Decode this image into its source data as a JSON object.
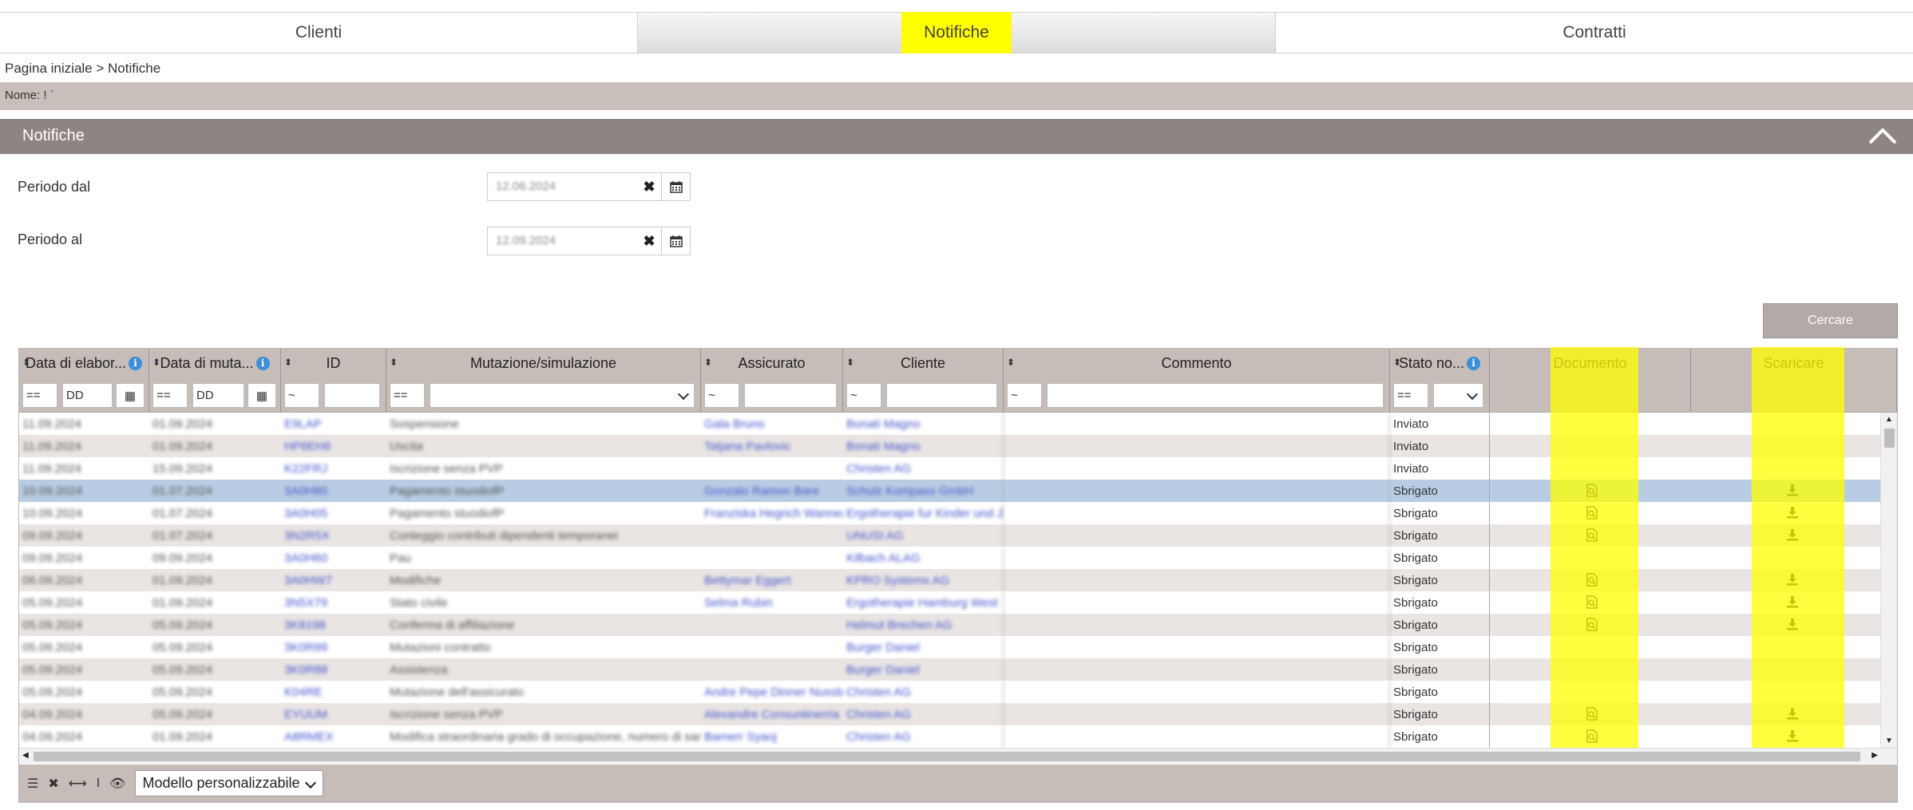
{
  "tabs": [
    {
      "label": "Clienti"
    },
    {
      "label": "Notifiche",
      "active": true
    },
    {
      "label": "Contratti"
    }
  ],
  "breadcrumb": "Pagina iniziale > Notifiche",
  "name_label": "Nome: ! `",
  "section_title": "Notifiche",
  "form": {
    "from_label": "Periodo dal",
    "from_value": "12.06.2024",
    "to_label": "Periodo al",
    "to_value": "12.09.2024"
  },
  "search_button": "Cercare",
  "columns": [
    {
      "label": "Data di elabor...",
      "info": true
    },
    {
      "label": "Data di muta...",
      "info": true
    },
    {
      "label": "ID"
    },
    {
      "label": "Mutazione/simulazione"
    },
    {
      "label": "Assicurato"
    },
    {
      "label": "Cliente"
    },
    {
      "label": "Commento"
    },
    {
      "label": "Stato no...",
      "info": true
    },
    {
      "label": "Documento"
    },
    {
      "label": "Scaricare"
    }
  ],
  "filters": {
    "op_eq": "==",
    "op_like": "~",
    "date_placeholder": "DD"
  },
  "rows": [
    {
      "d1": "11.09.2024",
      "d2": "01.09.2024",
      "id": "E9LAP",
      "mut": "Sospensione",
      "ass": "Gala Bruno",
      "cli": "Bonati Magno",
      "stato": "Inviato",
      "doc": false
    },
    {
      "d1": "11.09.2024",
      "d2": "01.09.2024",
      "id": "HP6EH6",
      "mut": "Uscita",
      "ass": "Tatjana Pavlovic",
      "cli": "Bonati Magno",
      "stato": "Inviato",
      "doc": false
    },
    {
      "d1": "11.09.2024",
      "d2": "15.09.2024",
      "id": "K22FRJ",
      "mut": "Iscrizione senza PVP",
      "ass": "",
      "cli": "Christen AG",
      "stato": "Inviato",
      "doc": false
    },
    {
      "d1": "10.09.2024",
      "d2": "01.07.2024",
      "id": "3A0H80",
      "mut": "Pagamento stuodiofP",
      "ass": "Gonzalo Ramon Bare",
      "cli": "Schulz Kompass GmbH",
      "stato": "Sbrigato",
      "doc": true,
      "selected": true
    },
    {
      "d1": "10.09.2024",
      "d2": "01.07.2024",
      "id": "3A0H05",
      "mut": "Pagamento stuodiofP",
      "ass": "Franziska Hegrich Wanner",
      "cli": "Ergotherapie fur Kinder und Jugend",
      "stato": "Sbrigato",
      "doc": true
    },
    {
      "d1": "09.09.2024",
      "d2": "01.07.2024",
      "id": "3N2R5X",
      "mut": "Conteggio contributi dipendenti temporanei",
      "ass": "",
      "cli": "UNUSI AG",
      "stato": "Sbrigato",
      "doc": true
    },
    {
      "d1": "09.09.2024",
      "d2": "09.09.2024",
      "id": "3A0H60",
      "mut": "Pau",
      "ass": "",
      "cli": "Kilbach ALAG",
      "stato": "Sbrigato",
      "doc": false
    },
    {
      "d1": "06.09.2024",
      "d2": "01.09.2024",
      "id": "3A0HW7",
      "mut": "Modifiche",
      "ass": "Bettymar Eggert",
      "cli": "KPRO Systems AG",
      "stato": "Sbrigato",
      "doc": true
    },
    {
      "d1": "05.09.2024",
      "d2": "01.09.2024",
      "id": "3N5X79",
      "mut": "Stato civile",
      "ass": "Selma Rubin",
      "cli": "Ergotherapie Hamburg West",
      "stato": "Sbrigato",
      "doc": true
    },
    {
      "d1": "05.09.2024",
      "d2": "05.09.2024",
      "id": "3K8198",
      "mut": "Conferma di affiliazione",
      "ass": "",
      "cli": "Helmut Brechen AG",
      "stato": "Sbrigato",
      "doc": true
    },
    {
      "d1": "05.09.2024",
      "d2": "05.09.2024",
      "id": "3K0R99",
      "mut": "Mutazioni contratto",
      "ass": "",
      "cli": "Burger Daniel",
      "stato": "Sbrigato",
      "doc": false
    },
    {
      "d1": "05.09.2024",
      "d2": "05.09.2024",
      "id": "3K0R88",
      "mut": "Assistenza",
      "ass": "",
      "cli": "Burger Daniel",
      "stato": "Sbrigato",
      "doc": false
    },
    {
      "d1": "05.09.2024",
      "d2": "05.09.2024",
      "id": "K04RE",
      "mut": "Mutazione dell'assicurato",
      "ass": "Andre Pepe Dinner Nussbaum",
      "cli": "Christen AG",
      "stato": "Sbrigato",
      "doc": false
    },
    {
      "d1": "04.09.2024",
      "d2": "05.09.2024",
      "id": "EYUUM",
      "mut": "Iscrizione senza PVP",
      "ass": "Alexandre Consuntinerria",
      "cli": "Christen AG",
      "stato": "Sbrigato",
      "doc": true
    },
    {
      "d1": "04.09.2024",
      "d2": "01.09.2024",
      "id": "A8RMEX",
      "mut": "Modifica straordinaria grado di occupazione, numero di sanzioni",
      "ass": "Bamerr Syaoj",
      "cli": "Christen AG",
      "stato": "Sbrigato",
      "doc": true
    }
  ],
  "footer": {
    "template_label": "Modello personalizzabile"
  },
  "colors": {
    "highlight": "#ffff00",
    "header_bg": "#c6bdb9",
    "section_bg": "#8e8582",
    "selected_row": "#b8cde3",
    "link": "#4455cc"
  }
}
